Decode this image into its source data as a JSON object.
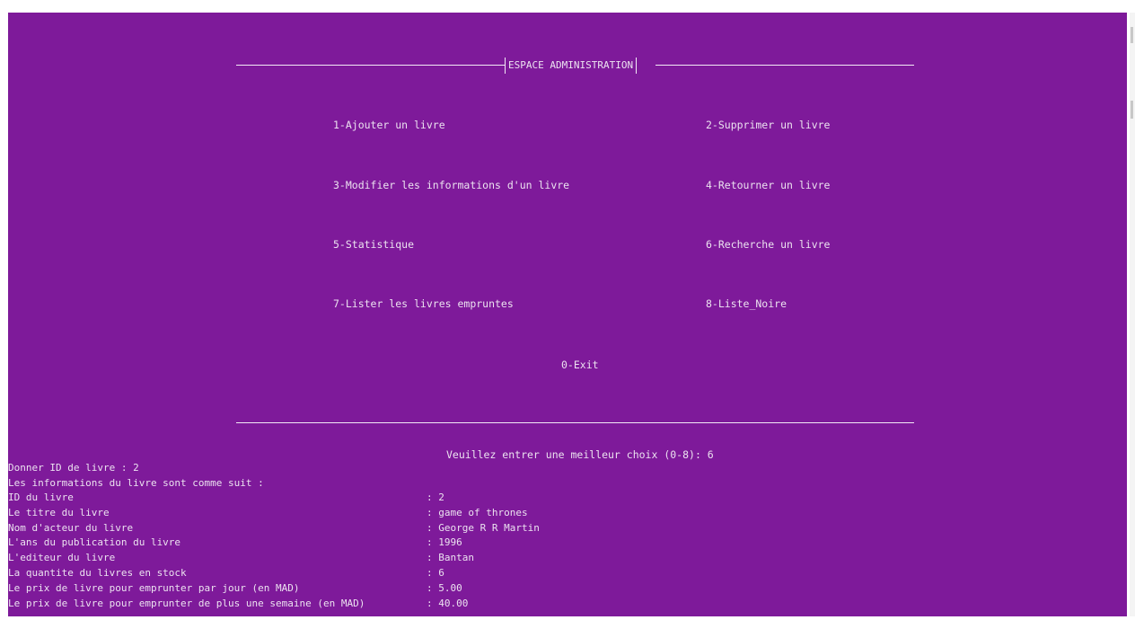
{
  "console": {
    "background_color": "#7e1a9a",
    "text_color": "#ece2f0"
  },
  "header": {
    "title": "ESPACE ADMINISTRATION"
  },
  "menu": {
    "items": [
      {
        "label": "1-Ajouter un livre"
      },
      {
        "label": "2-Supprimer un livre"
      },
      {
        "label": "3-Modifier les informations d'un livre"
      },
      {
        "label": "4-Retourner un livre"
      },
      {
        "label": "5-Statistique"
      },
      {
        "label": "6-Recherche un livre"
      },
      {
        "label": "7-Lister les livres empruntes"
      },
      {
        "label": "8-Liste_Noire"
      },
      {
        "label": "0-Exit"
      }
    ]
  },
  "prompt": {
    "text": "Veuillez entrer une meilleur choix (0-8): 6"
  },
  "output": {
    "id_prompt": "Donner ID de livre : 2",
    "intro": "Les informations du livre sont comme suit :",
    "rows": [
      {
        "label": "ID du livre",
        "value": ": 2"
      },
      {
        "label": "Le titre du livre",
        "value": ": game of thrones"
      },
      {
        "label": "Nom d'acteur du livre",
        "value": ": George R R Martin"
      },
      {
        "label": "L'ans du publication du livre",
        "value": ": 1996"
      },
      {
        "label": "L'editeur du livre",
        "value": ": Bantan"
      },
      {
        "label": "La quantite du livres en stock",
        "value": ": 6"
      },
      {
        "label": "Le prix de livre pour emprunter par jour (en MAD)",
        "value": ": 5.00"
      },
      {
        "label": "Le prix de livre pour emprunter de plus une semaine (en MAD)",
        "value": ": 40.00"
      }
    ]
  }
}
